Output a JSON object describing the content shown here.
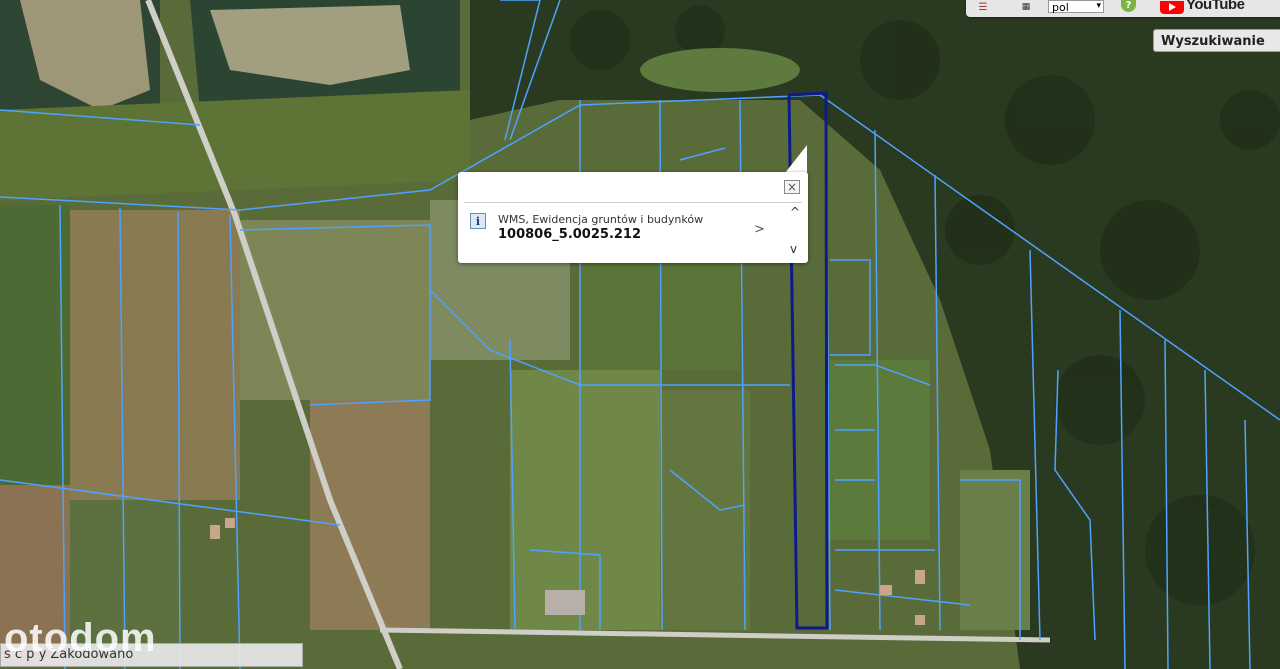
{
  "toolbar": {
    "language": "pol",
    "help_icon": "question-icon",
    "youtube_label": "YouTube"
  },
  "search_button": "Wyszukiwanie",
  "popup": {
    "layer_name": "WMS, Ewidencja gruntów i budynków",
    "parcel_id": "100806_5.0025.212",
    "close_icon": "close-icon",
    "close_glyph": "×",
    "next_glyph": ">",
    "up_glyph": "^",
    "down_glyph": "v"
  },
  "status_bar": "s  c   p   y  Zakodowano",
  "watermark": "otodom",
  "colors": {
    "parcel_lines": "#4da3ff",
    "selected_parcel": "#0d1a8a",
    "forest": "#2b3d22",
    "field": "#9a8a5a"
  }
}
